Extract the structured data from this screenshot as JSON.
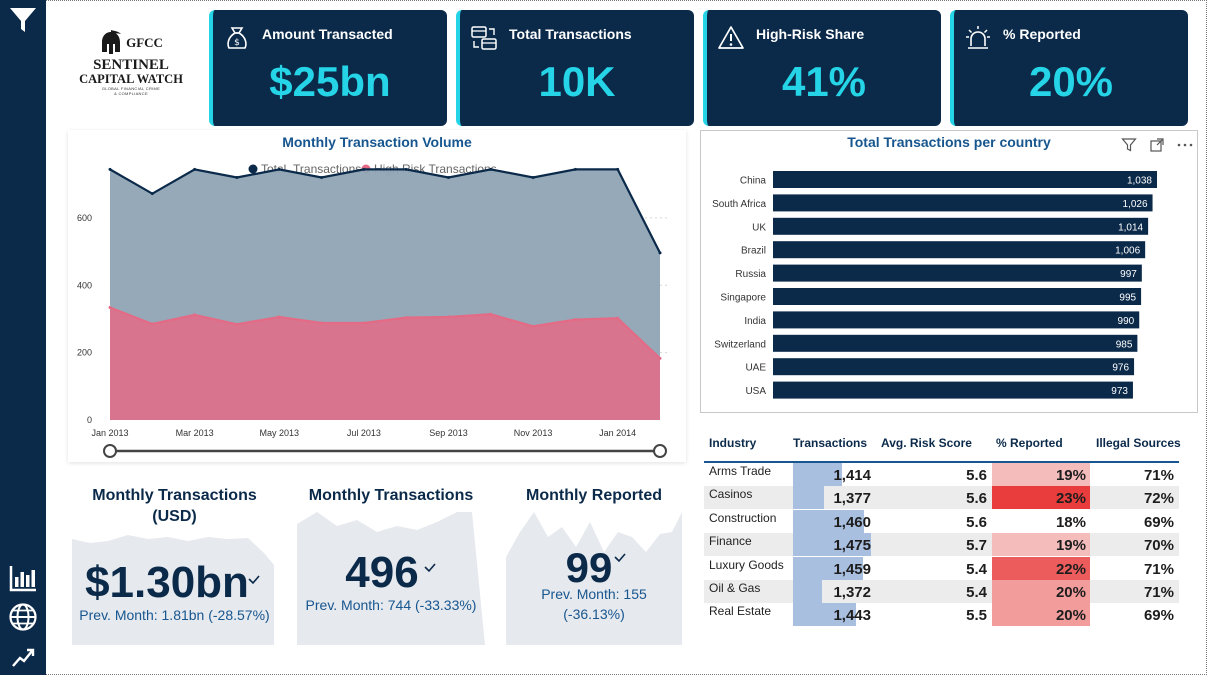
{
  "brand": {
    "abbr": "GFCC",
    "name_line1": "SENTINEL",
    "name_line2": "CAPITAL WATCH",
    "tagline_line1": "GLOBAL FINANCIAL CRIME",
    "tagline_line2": "& COMPLIANCE"
  },
  "nav": {
    "items": [
      {
        "icon": "filter-icon"
      },
      {
        "icon": "bar-chart-icon"
      },
      {
        "icon": "globe-icon"
      },
      {
        "icon": "trend-line-icon"
      }
    ]
  },
  "kpis": [
    {
      "label": "Amount Transacted",
      "value": "$25bn",
      "icon": "money-bag-icon"
    },
    {
      "label": "Total Transactions",
      "value": "10K",
      "icon": "transfer-icon"
    },
    {
      "label": "High-Risk Share",
      "value": "41%",
      "icon": "warning-icon"
    },
    {
      "label": "% Reported",
      "value": "20%",
      "icon": "alarm-icon"
    }
  ],
  "colors": {
    "navy": "#0b2a4a",
    "accent": "#25d4e6",
    "total_series": "#8fa4b4",
    "high_risk_series": "#e46b86"
  },
  "chart_data": [
    {
      "type": "area",
      "title": "Monthly Transaction Volume",
      "x_ticks": [
        "Jan 2013",
        "Mar 2013",
        "May 2013",
        "Jul 2013",
        "Sep 2013",
        "Nov 2013",
        "Jan 2014"
      ],
      "y_ticks": [
        "0",
        "200",
        "400",
        "600"
      ],
      "ylim": [
        0,
        760
      ],
      "grid": true,
      "legend_position": "top",
      "x": [
        "Jan 2013",
        "Feb 2013",
        "Mar 2013",
        "Apr 2013",
        "May 2013",
        "Jun 2013",
        "Jul 2013",
        "Aug 2013",
        "Sep 2013",
        "Oct 2013",
        "Nov 2013",
        "Dec 2013",
        "Jan 2014",
        "Feb 2014"
      ],
      "series": [
        {
          "name": "Total_Transactions",
          "values": [
            744,
            672,
            744,
            720,
            744,
            720,
            744,
            744,
            720,
            744,
            720,
            744,
            744,
            496
          ]
        },
        {
          "name": "High Risk Transactions",
          "values": [
            334,
            285,
            312,
            284,
            306,
            288,
            288,
            304,
            306,
            314,
            278,
            298,
            302,
            183
          ]
        }
      ]
    },
    {
      "type": "bar",
      "orientation": "horizontal",
      "title": "Total Transactions per country",
      "categories": [
        "China",
        "South Africa",
        "UK",
        "Brazil",
        "Russia",
        "Singapore",
        "India",
        "Switzerland",
        "UAE",
        "USA"
      ],
      "values": [
        1038,
        1026,
        1014,
        1006,
        997,
        995,
        990,
        985,
        976,
        973
      ],
      "data_labels": [
        "1,038",
        "1,026",
        "1,014",
        "1,006",
        "997",
        "995",
        "990",
        "985",
        "976",
        "973"
      ]
    },
    {
      "type": "table",
      "columns": [
        "Industry",
        "Transactions",
        "Avg. Risk Score",
        "% Reported",
        "Illegal Sources"
      ],
      "rows": [
        {
          "industry": "Arms Trade",
          "transactions": "1,414",
          "tx_value": 1414,
          "risk": "5.6",
          "reported": "19%",
          "reported_value": 19,
          "illegal": "71%"
        },
        {
          "industry": "Casinos",
          "transactions": "1,377",
          "tx_value": 1377,
          "risk": "5.6",
          "reported": "23%",
          "reported_value": 23,
          "illegal": "72%"
        },
        {
          "industry": "Construction",
          "transactions": "1,460",
          "tx_value": 1460,
          "risk": "5.6",
          "reported": "18%",
          "reported_value": 18,
          "illegal": "69%"
        },
        {
          "industry": "Finance",
          "transactions": "1,475",
          "tx_value": 1475,
          "risk": "5.7",
          "reported": "19%",
          "reported_value": 19,
          "illegal": "70%"
        },
        {
          "industry": "Luxury Goods",
          "transactions": "1,459",
          "tx_value": 1459,
          "risk": "5.4",
          "reported": "22%",
          "reported_value": 22,
          "illegal": "71%"
        },
        {
          "industry": "Oil & Gas",
          "transactions": "1,372",
          "tx_value": 1372,
          "risk": "5.4",
          "reported": "20%",
          "reported_value": 20,
          "illegal": "71%"
        },
        {
          "industry": "Real Estate",
          "transactions": "1,443",
          "tx_value": 1443,
          "risk": "5.5",
          "reported": "20%",
          "reported_value": 20,
          "illegal": "69%"
        }
      ]
    }
  ],
  "bottom_cards": [
    {
      "title_line1": "Monthly Transactions",
      "title_line2": "(USD)",
      "value": "$1.30bn",
      "sub_line1": "Prev. Month: 1.81bn (-28.57%)",
      "sub_line2": ""
    },
    {
      "title_line1": "Monthly Transactions",
      "title_line2": "",
      "value": "496",
      "sub_line1": "Prev. Month: 744 (-33.33%)",
      "sub_line2": ""
    },
    {
      "title_line1": "Monthly Reported",
      "title_line2": "",
      "value": "99",
      "sub_line1": "Prev. Month: 155",
      "sub_line2": "(-36.13%)"
    }
  ],
  "visual_header_icons": [
    "filter-icon",
    "focus-mode-icon",
    "more-options-icon"
  ]
}
